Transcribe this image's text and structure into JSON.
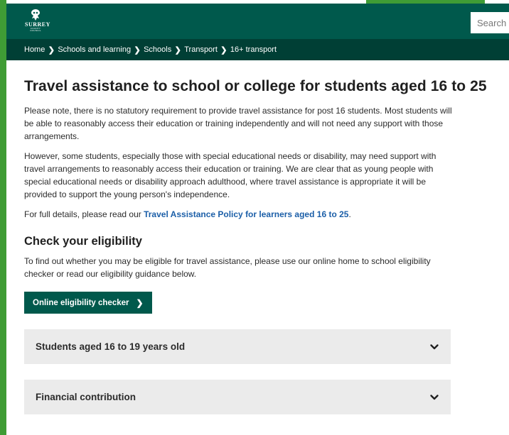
{
  "header": {
    "logo_word": "SURREY",
    "logo_subtitle": "COUNTY COUNCIL",
    "search_placeholder": "Search site"
  },
  "breadcrumb": [
    "Home",
    "Schools and learning",
    "Schools",
    "Transport",
    "16+ transport"
  ],
  "main": {
    "title": "Travel assistance to school or college for students aged 16 to 25",
    "paragraph1": "Please note, there is no statutory requirement to provide travel assistance for post 16 students. Most students will be able to reasonably access their education or training independently and will not need any support with those arrangements.",
    "paragraph2": "However, some students, especially those with special educational needs or disability, may need support with travel arrangements to reasonably access their education or training. We are clear that as young people with special educational needs or disability approach adulthood, where travel assistance is appropriate it will be provided to support the young person's independence.",
    "paragraph3_prefix": "For full details, please read our ",
    "paragraph3_link": "Travel Assistance Policy for learners aged 16 to 25",
    "paragraph3_suffix": ".",
    "eligibility_heading": "Check your eligibility",
    "eligibility_text": "To find out whether you may be eligible for travel assistance, please use our online home to school eligibility checker or read our eligibility guidance below.",
    "checker_button": "Online eligibility checker",
    "accordions": [
      {
        "label": "Students aged 16 to 19 years old"
      },
      {
        "label": "Financial contribution"
      }
    ]
  },
  "colors": {
    "header_green": "#00594c",
    "breadcrumb_green": "#003f35",
    "accent_green": "#3f9c35",
    "link_blue": "#1c5fa8",
    "accordion_bg": "#ebebeb"
  }
}
